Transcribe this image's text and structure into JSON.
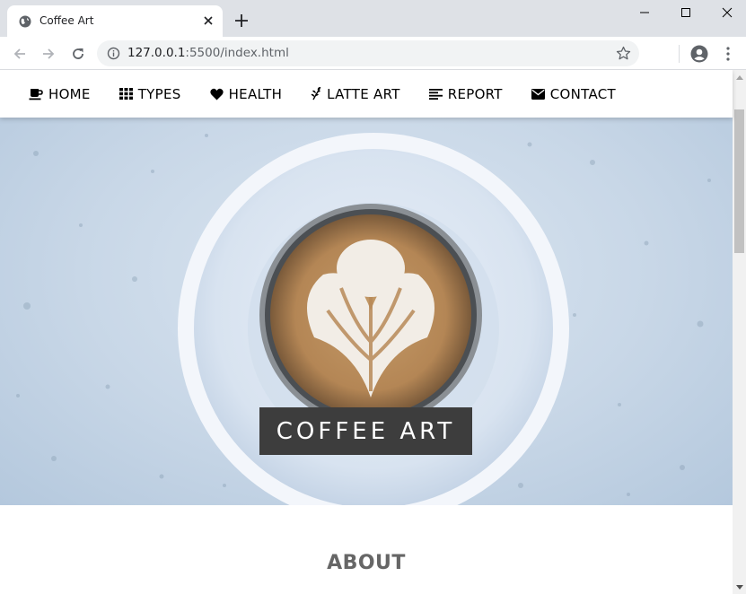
{
  "browser": {
    "tab_title": "Coffee Art",
    "url_host": "127.0.0.1",
    "url_rest": ":5500/index.html"
  },
  "nav": {
    "items": [
      {
        "label": "HOME",
        "icon": "coffee-cup-icon"
      },
      {
        "label": "TYPES",
        "icon": "grid-icon"
      },
      {
        "label": "HEALTH",
        "icon": "heart-icon"
      },
      {
        "label": "LATTE ART",
        "icon": "leaf-icon"
      },
      {
        "label": "REPORT",
        "icon": "align-left-icon"
      },
      {
        "label": "CONTACT",
        "icon": "envelope-icon"
      }
    ]
  },
  "hero": {
    "title": "COFFEE ART"
  },
  "about": {
    "heading": "ABOUT"
  },
  "colors": {
    "nav_text": "#000000",
    "hero_title_bg": "#3d3d3d",
    "about_heading": "#666666",
    "chrome_tabstrip": "#dee1e6"
  }
}
